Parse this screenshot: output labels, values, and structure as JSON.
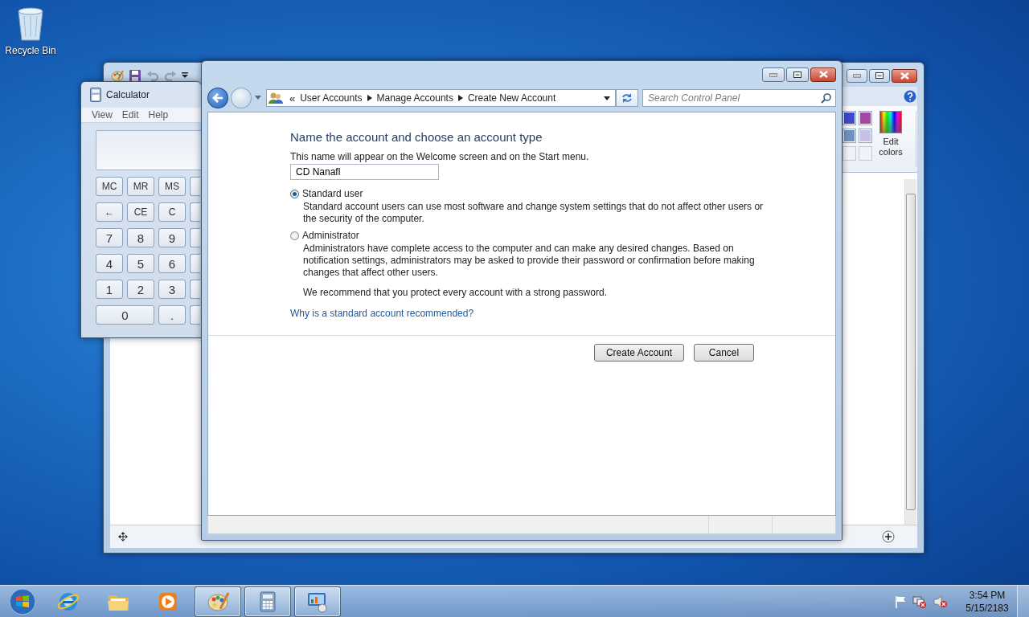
{
  "desktop": {
    "icons": [
      {
        "label": "Recycle Bin"
      }
    ]
  },
  "paint_window": {
    "colors": [
      {
        "color": "#3f48cc"
      },
      {
        "color": "#a349a4"
      },
      {
        "color": "#7092be"
      },
      {
        "color": "#c8bfe7"
      }
    ],
    "edit_colors": "Edit colors"
  },
  "calculator": {
    "title": "Calculator",
    "menu": [
      "View",
      "Edit",
      "Help"
    ],
    "keys": [
      [
        {
          "label": "MC"
        },
        {
          "label": "MR"
        },
        {
          "label": "MS"
        },
        {
          "kind": "blank"
        }
      ],
      [
        {
          "label": "←"
        },
        {
          "label": "CE"
        },
        {
          "label": "C"
        },
        {
          "kind": "blank"
        }
      ],
      [
        {
          "label": "7"
        },
        {
          "label": "8"
        },
        {
          "label": "9"
        },
        {
          "kind": "blank"
        }
      ],
      [
        {
          "label": "4"
        },
        {
          "label": "5"
        },
        {
          "label": "6"
        },
        {
          "kind": "blank"
        }
      ],
      [
        {
          "label": "1"
        },
        {
          "label": "2"
        },
        {
          "label": "3"
        },
        {
          "kind": "blank"
        }
      ],
      [
        {
          "label": "0",
          "kind": "wide"
        },
        {
          "label": "."
        },
        {
          "kind": "blank"
        }
      ]
    ]
  },
  "control_panel": {
    "overflow": "«",
    "breadcrumbs": [
      "User Accounts",
      "Manage Accounts",
      "Create New Account"
    ],
    "search": {
      "placeholder": "Search Control Panel"
    },
    "heading": "Name the account and choose an account type",
    "name_hint": "This name will appear on the Welcome screen and on the Start menu.",
    "name_field": {
      "value": "CD Nanafl"
    },
    "account_types": [
      {
        "label": "Standard user",
        "description": "Standard account users can use most software and change system settings that do not affect other users or the security of the computer.",
        "selected": true
      },
      {
        "label": "Administrator",
        "description": "Administrators have complete access to the computer and can make any desired changes. Based on notification settings, administrators may be asked to provide their password or confirmation before making changes that affect other users.",
        "selected": false
      }
    ],
    "recommendation": "We recommend that you protect every account with a strong password.",
    "help_link": "Why is a standard account recommended?",
    "buttons": [
      "Create Account",
      "Cancel"
    ]
  },
  "taskbar": {
    "apps": [
      {
        "kind": "browser",
        "open": false
      },
      {
        "kind": "folder",
        "open": false
      },
      {
        "kind": "media",
        "open": false
      },
      {
        "kind": "paint",
        "open": true
      },
      {
        "kind": "calculator",
        "open": true
      },
      {
        "kind": "control_panel",
        "open": true
      }
    ],
    "tray": {
      "time": "3:54 PM",
      "date": "5/15/2183"
    }
  }
}
